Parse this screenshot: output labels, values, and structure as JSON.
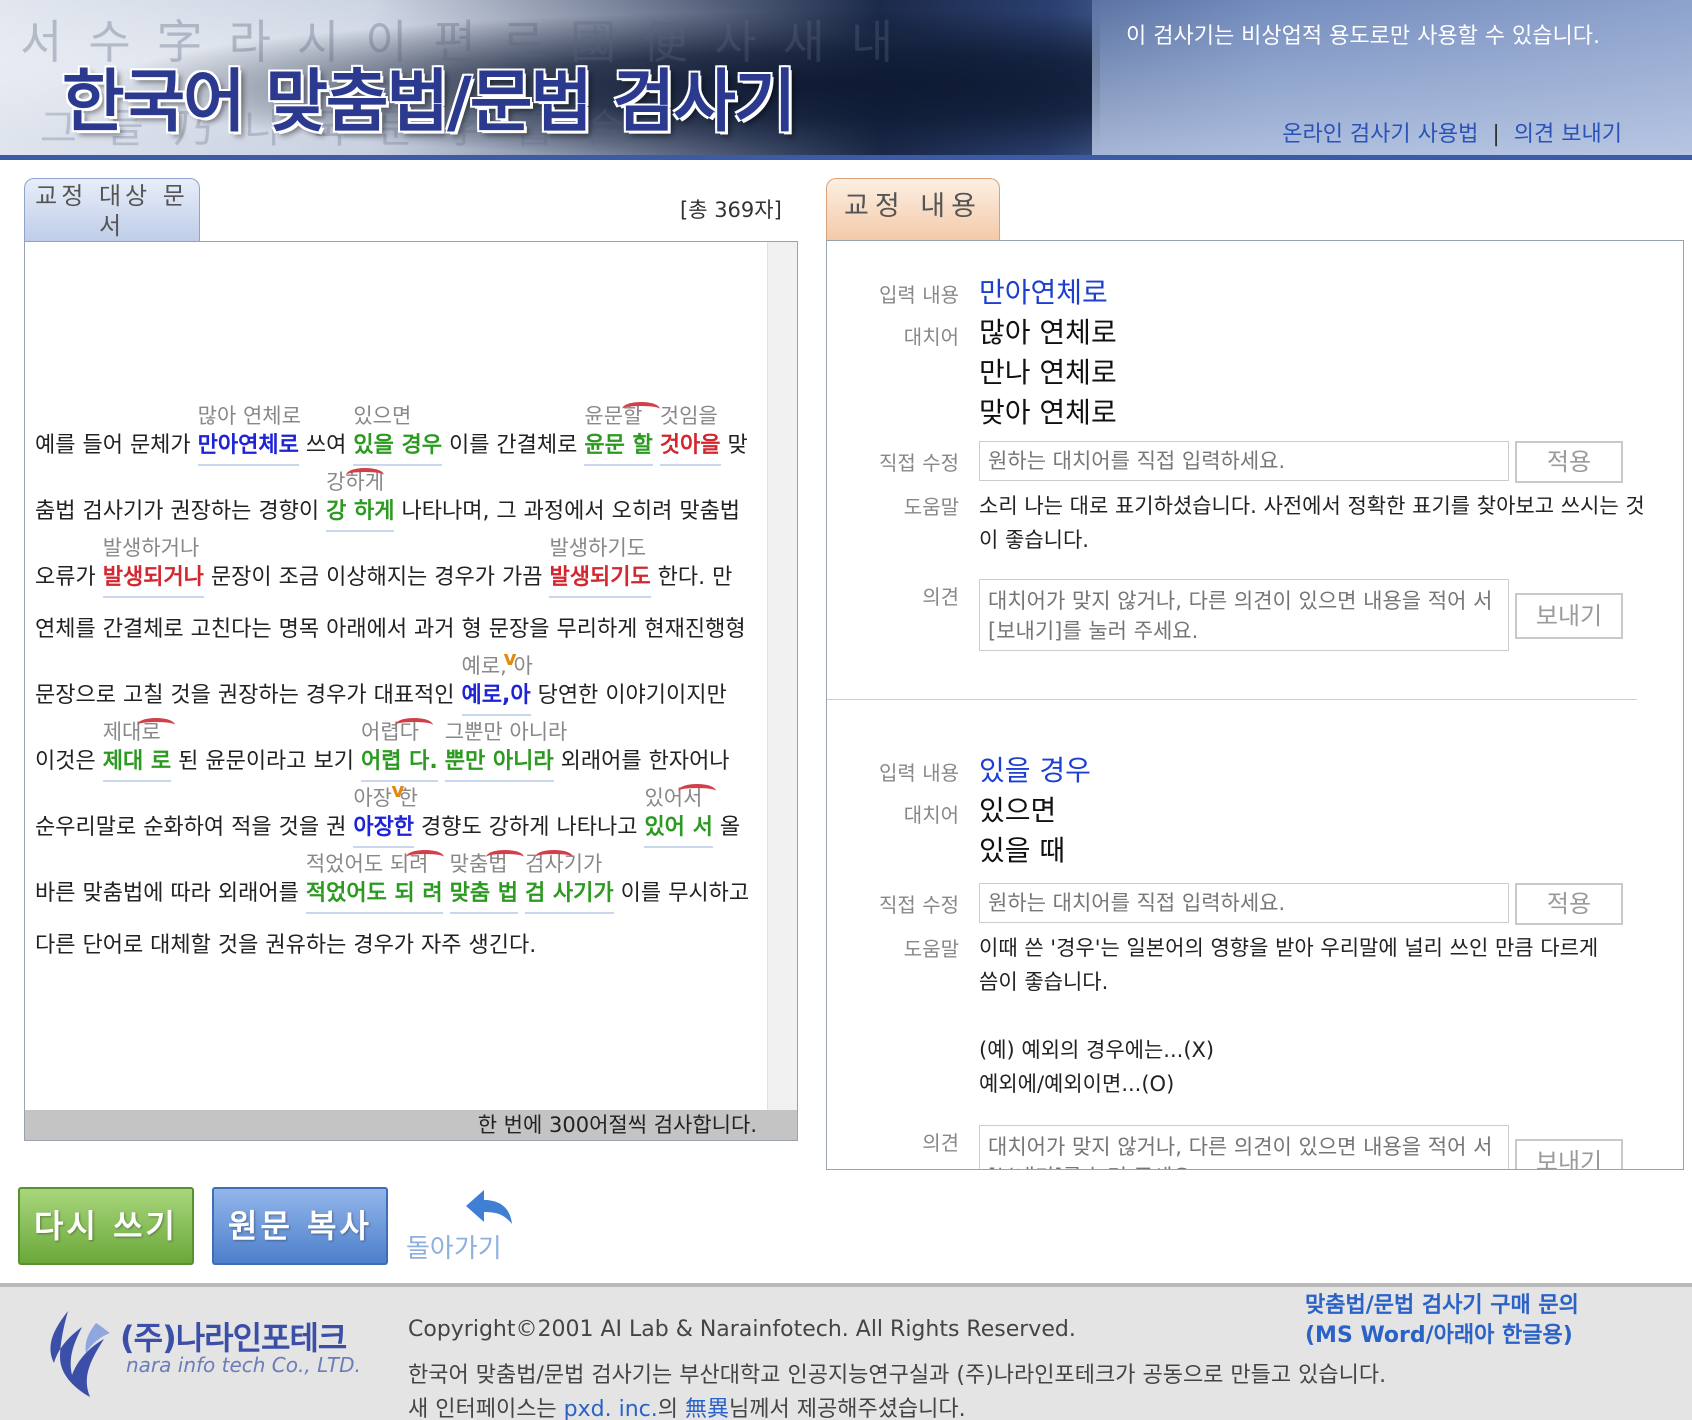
{
  "header": {
    "title": "한국어 맞춤법/문법 검사기",
    "notice": "이 검사기는 비상업적 용도로만 사용할 수 있습니다.",
    "links": {
      "usage": "온라인 검사기 사용법",
      "feedback": "의견 보내기",
      "separator": "|"
    }
  },
  "left_panel": {
    "tab_label": "교정 대상 문서",
    "char_count": "[총 369자]",
    "footer_note": "한 번에 300어절씩 검사합니다.",
    "lines": [
      {
        "segments": [
          "예를 들어 문체가 ",
          "만아연체로",
          " 쓰여 ",
          "있을 경우",
          " 이를 간결체로 ",
          "윤문 할",
          " ",
          "것아을",
          " 맞"
        ],
        "suggestions": [
          "많아 연체로",
          "있으면",
          "윤문할",
          "것임을"
        ]
      },
      {
        "segments": [
          "춤법 검사기가 권장하는 경향이 ",
          "강 하게",
          " 나타나며, 그 과정에서 오히려 맞춤법"
        ],
        "suggestions": [
          "강하게"
        ]
      },
      {
        "segments": [
          "오류가 ",
          "발생되거나",
          " 문장이 조금 이상해지는 경우가 가끔 ",
          "발생되기도",
          " 한다. 만"
        ],
        "suggestions": [
          "발생하거나",
          "발생하기도"
        ]
      },
      {
        "segments": [
          "연체를 간결체로 고친다는 명목 아래에서 과거 형 문장을 무리하게 현재진행형"
        ]
      },
      {
        "segments": [
          "문장으로 고칠 것을 권장하는 경우가 대표적인 ",
          "예로,아",
          " 당연한 이야기이지만"
        ],
        "suggestions": [
          "예로, 아"
        ]
      },
      {
        "segments": [
          "이것은 ",
          "제대 로",
          " 된 윤문이라고 보기 ",
          "어렵 다.",
          " ",
          "뿐만 아니라",
          " 외래어를 한자어나"
        ],
        "suggestions": [
          "제대로",
          "어렵다",
          "그뿐만 아니라"
        ]
      },
      {
        "segments": [
          "순우리말로 순화하여 적을 것을 권 ",
          "아장한",
          " 경향도 강하게 나타나고 ",
          "있어 서",
          " 올"
        ],
        "suggestions": [
          "아장 한",
          "있어서"
        ]
      },
      {
        "segments": [
          "바른 맞춤법에 따라 외래어를 ",
          "적었어도 되 려",
          " ",
          "맞춤 법",
          " ",
          "검 사기가",
          " 이를 무시하고"
        ],
        "suggestions": [
          "적었어도 되려",
          "맞춤법",
          "검사기가"
        ]
      },
      {
        "segments": [
          "다른 단어로 대체할 것을 권유하는 경우가 자주 생긴다."
        ]
      }
    ]
  },
  "right_panel": {
    "tab_label": "교정 내용",
    "labels": {
      "input": "입력 내용",
      "replace": "대치어",
      "direct": "직접 수정",
      "help": "도움말",
      "opinion": "의견"
    },
    "apply_button": "적용",
    "send_button": "보내기",
    "direct_placeholder": "원하는 대치어를 직접 입력하세요.",
    "opinion_placeholder": "대치어가 맞지 않거나, 다른 의견이 있으면 내용을 적어 서 [보내기]를 눌러 주세요.",
    "corrections": [
      {
        "input": "만아연체로",
        "candidates": [
          "많아 연체로",
          "만나 연체로",
          "맞아 연체로"
        ],
        "help": "소리 나는 대로 표기하셨습니다. 사전에서 정확한 표기를 찾아보고 쓰시는 것이 좋습니다."
      },
      {
        "input": "있을 경우",
        "candidates": [
          "있으면",
          "있을 때"
        ],
        "help_lines": [
          "이때 쓴 '경우'는 일본어의 영향을 받아 우리말에 널리 쓰인 만큼 다르게",
          "씀이 좋습니다.",
          "",
          "(예) 예외의 경우에는...(X)",
          "예외에/예외이면...(O)"
        ]
      }
    ]
  },
  "buttons": {
    "rewrite": "다시 쓰기",
    "copy": "원문 복사",
    "back": "돌아가기"
  },
  "footer": {
    "logo_ko": "(주)나라인포테크",
    "logo_en": "nara info tech Co., LTD.",
    "copyright": "Copyright©2001 AI Lab & Narainfotech. All Rights Reserved.",
    "credit1": "한국어 맞춤법/문법 검사기는 부산대학교 인공지능연구실과 (주)나라인포테크가 공동으로 만들고 있습니다.",
    "credit2_pre": "새 인터페이스는 ",
    "credit2_link1": "pxd. inc.",
    "credit2_mid": "의 ",
    "credit2_link2": "無異",
    "credit2_post": "님께서 제공해주셨습니다.",
    "buy_line1": "맞춤법/문법 검사기 구매 문의",
    "buy_line2": "(MS Word/아래아 한글용)"
  },
  "colors": {
    "error_blue": "#1f23d6",
    "error_green": "#2c9a21",
    "error_red": "#d3262f",
    "link": "#2a62c8",
    "accent": "#3b5aa8"
  }
}
